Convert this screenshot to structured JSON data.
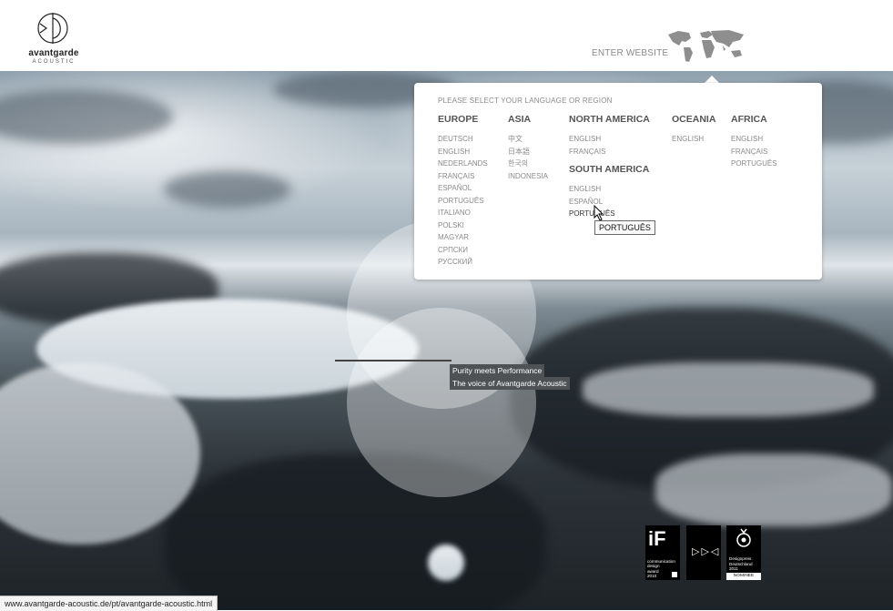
{
  "brand": {
    "name": "avantgarde",
    "sub": "ACOUSTIC"
  },
  "header": {
    "enter_label": "ENTER WEBSITE"
  },
  "selector": {
    "prompt": "PLEASE SELECT YOUR LANGUAGE OR REGION",
    "regions": [
      {
        "name": "EUROPE",
        "languages": [
          "DEUTSCH",
          "ENGLISH",
          "NEDERLANDS",
          "FRANÇAIS",
          "ESPAÑOL",
          "PORTUGUÊS",
          "ITALIANO",
          "POLSKI",
          "MAGYAR",
          "СРПСКИ",
          "РУССКИЙ"
        ]
      },
      {
        "name": "ASIA",
        "languages": [
          "中文",
          "日本語",
          "한국의",
          "INDONESIA"
        ]
      },
      {
        "name": "NORTH AMERICA",
        "languages": [
          "ENGLISH",
          "FRANÇAIS"
        ]
      },
      {
        "name": "SOUTH AMERICA",
        "languages": [
          "ENGLISH",
          "ESPAÑOL",
          "PORTUGUÊS"
        ]
      },
      {
        "name": "OCEANIA",
        "languages": [
          "ENGLISH"
        ]
      },
      {
        "name": "AFRICA",
        "languages": [
          "ENGLISH",
          "FRANÇAIS",
          "PORTUGUÊS"
        ]
      }
    ],
    "tooltip": "PORTUGUÊS"
  },
  "taglines": [
    "Purity meets Performance",
    "The voice of Avantgarde Acoustic"
  ],
  "awards": [
    {
      "icon": "if-award-icon",
      "logo": "iF",
      "text": [
        "communication",
        "design",
        "award",
        "2010"
      ]
    },
    {
      "icon": "german-design-council-icon",
      "logo": "▷▷◁",
      "text": []
    },
    {
      "icon": "designpreis-icon",
      "text": [
        "Designpreis",
        "Deutschland",
        "2011"
      ],
      "badge": "NOMINEE"
    }
  ],
  "status_url": "www.avantgarde-acoustic.de/pt/avantgarde-acoustic.html"
}
